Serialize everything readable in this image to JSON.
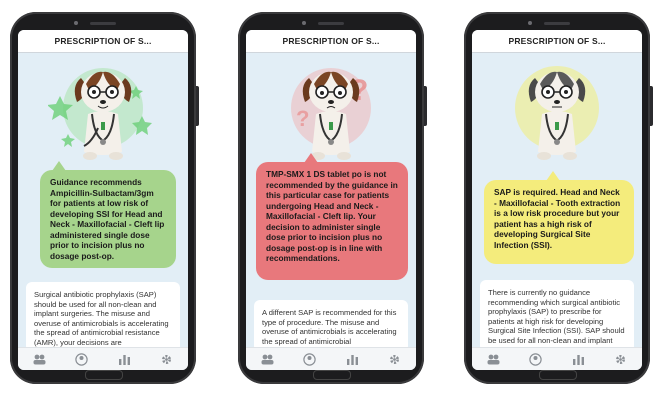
{
  "screens": [
    {
      "title": "PRESCRIPTION OF S...",
      "mood": "good",
      "bubble_color": "#a6d48c",
      "glow_color": "#7ed47e",
      "bubble_text": "Guidance recommends Ampicillin-Sulbactam/3gm for patients at low risk of developing SSI for Head and Neck - Maxillofacial - Cleft lip administered single dose prior to incision plus no dosage post-op.",
      "info_text": "Surgical antibiotic prophylaxis (SAP) should be used for all non-clean and implant surgeries. The misuse and overuse of antimicrobials is accelerating the spread of antimicrobial resistance (AMR), your decisions are"
    },
    {
      "title": "PRESCRIPTION OF S...",
      "mood": "bad",
      "bubble_color": "#e8787c",
      "glow_color": "#f08a8a",
      "bubble_text": "TMP-SMX 1 DS tablet po is not recommended by the guidance in this particular case for patients undergoing Head and Neck - Maxillofacial - Cleft lip. Your decision to administer single dose prior to incision plus no dosage post-op is in line with recommendations.",
      "info_text": "A different SAP is recommended for this type of procedure. The misuse and overuse of antimicrobials is accelerating the spread of antimicrobial"
    },
    {
      "title": "PRESCRIPTION OF S...",
      "mood": "neutral",
      "bubble_color": "#f4ec7c",
      "glow_color": "#f2ea6a",
      "bubble_text": "SAP is required. Head and Neck - Maxillofacial - Tooth extraction is a low risk procedure but your patient has a high risk of developing Surgical Site Infection (SSI).",
      "info_text": "There is currently no guidance recommending which surgical antibiotic prophylaxis (SAP) to prescribe for patients at high risk for developing Surgical Site Infection (SSI). SAP should be used for all non-clean and implant surgeries. Patients with"
    }
  ],
  "nav_icons": [
    "team-icon",
    "profile-icon",
    "stats-icon",
    "settings-icon"
  ]
}
